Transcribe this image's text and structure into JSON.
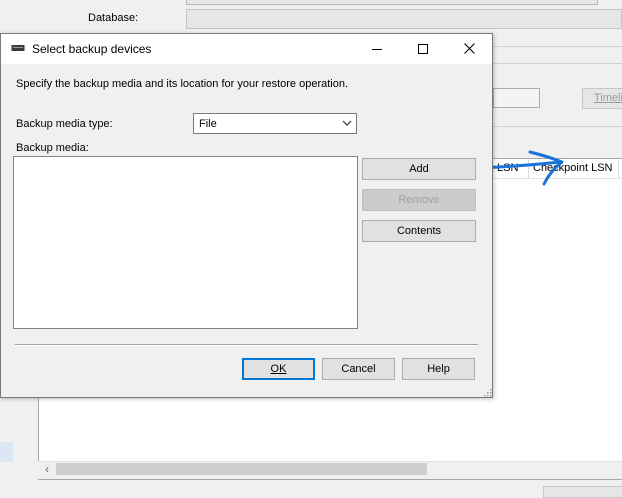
{
  "background": {
    "database_label": "Database:",
    "timeline_button": "Timeline...",
    "grid_columns": [
      "LSN",
      "Checkpoint LSN"
    ]
  },
  "dialog": {
    "title": "Select backup devices",
    "instruction": "Specify the backup media and its location for your restore operation.",
    "media_type_label": "Backup media type:",
    "media_type_value": "File",
    "media_label": "Backup media:",
    "buttons": {
      "add": "Add",
      "remove": "Remove",
      "contents": "Contents",
      "ok": "OK",
      "cancel": "Cancel",
      "help": "Help"
    }
  },
  "colors": {
    "accent": "#0078d7",
    "annotation_stroke": "#1a73d9"
  },
  "icons": [
    "tape-drive-icon",
    "minimize-icon",
    "maximize-icon",
    "close-icon",
    "chevron-down-icon",
    "resize-grip-icon",
    "scroll-left-icon"
  ]
}
